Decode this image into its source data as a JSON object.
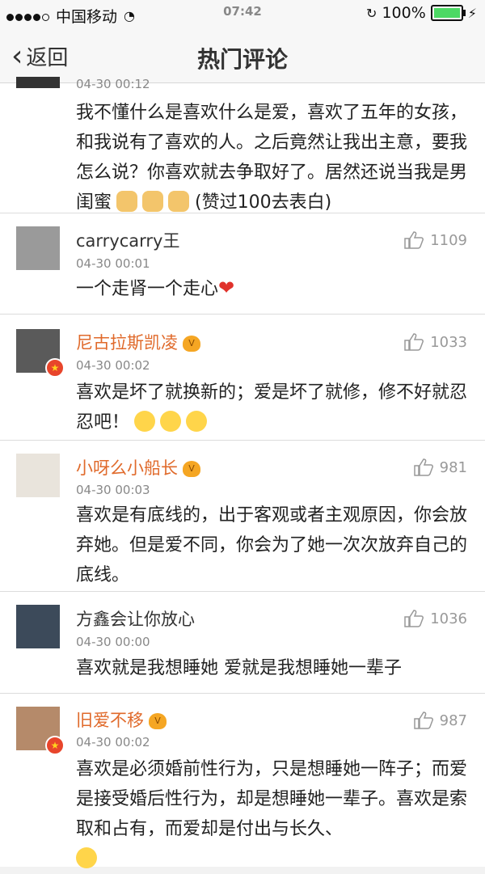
{
  "status": {
    "carrier": "中国移动",
    "time": "07:42",
    "battery": "100%",
    "colors": {
      "battery_fill": "#4cd964"
    }
  },
  "nav": {
    "back_label": "返回",
    "title": "热门评论"
  },
  "comments": [
    {
      "time": "04-30 00:12",
      "text": "我不懂什么是喜欢什么是爱，喜欢了五年的女孩，和我说有了喜欢的人。之后竟然让我出主意，要我怎么说？你喜欢就去争取好了。居然还说当我是男闺蜜",
      "text_suffix": "(赞过100去表白)"
    },
    {
      "username": "carrycarry王",
      "time": "04-30 00:01",
      "likes": "1109",
      "text": "一个走肾一个走心"
    },
    {
      "username": "尼古拉斯凯凌",
      "time": "04-30 00:02",
      "likes": "1033",
      "text": "喜欢是坏了就换新的；爱是坏了就修，修不好就忍忍吧！"
    },
    {
      "username": "小呀么小船长",
      "time": "04-30 00:03",
      "likes": "981",
      "text": "喜欢是有底线的，出于客观或者主观原因，你会放弃她。但是爱不同，你会为了她一次次放弃自己的底线。"
    },
    {
      "username": "方鑫会让你放心",
      "time": "04-30 00:00",
      "likes": "1036",
      "text": "喜欢就是我想睡她 爱就是我想睡她一辈子"
    },
    {
      "username": "旧爱不移",
      "time": "04-30 00:02",
      "likes": "987",
      "text": "喜欢是必须婚前性行为，只是想睡她一阵子；而爱是接受婚后性行为，却是想睡她一辈子。喜欢是索取和占有，而爱却是付出与长久、"
    }
  ]
}
